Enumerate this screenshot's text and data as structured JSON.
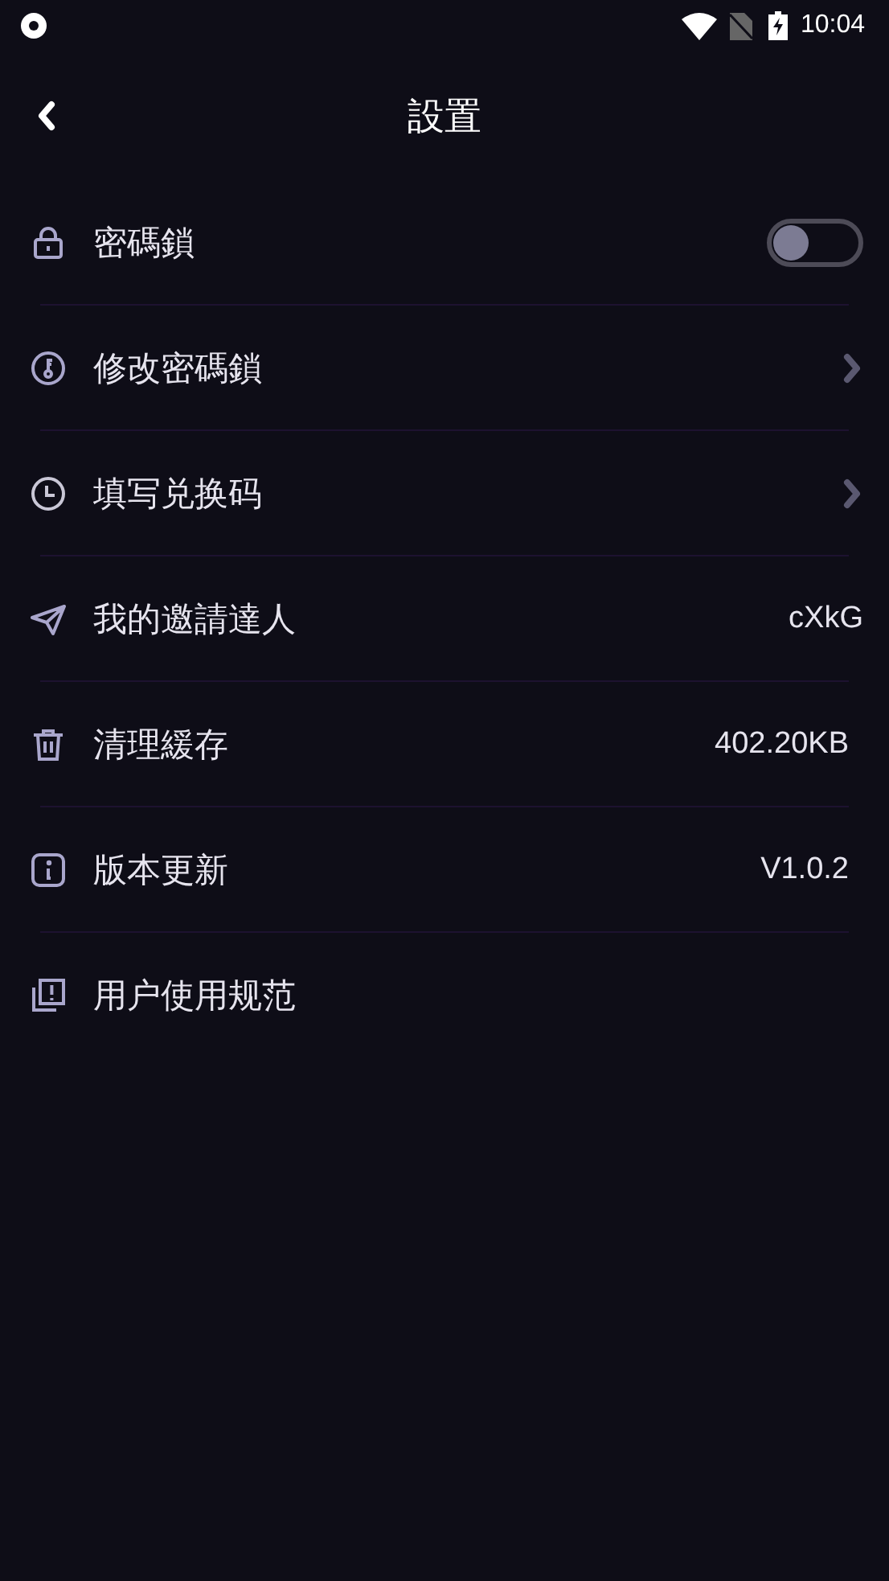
{
  "status_bar": {
    "time": "10:04"
  },
  "header": {
    "title": "設置"
  },
  "settings": [
    {
      "kind": "toggle",
      "label": "密碼鎖",
      "on": false
    },
    {
      "kind": "link",
      "label": "修改密碼鎖"
    },
    {
      "kind": "link",
      "label": "填写兑换码"
    },
    {
      "kind": "value",
      "label": "我的邀請達人",
      "value": "cXkG"
    },
    {
      "kind": "value",
      "label": "清理緩存",
      "value": "402.20KB"
    },
    {
      "kind": "value",
      "label": "版本更新",
      "value": "V1.0.2"
    },
    {
      "kind": "plain",
      "label": "用户使用规范"
    }
  ]
}
